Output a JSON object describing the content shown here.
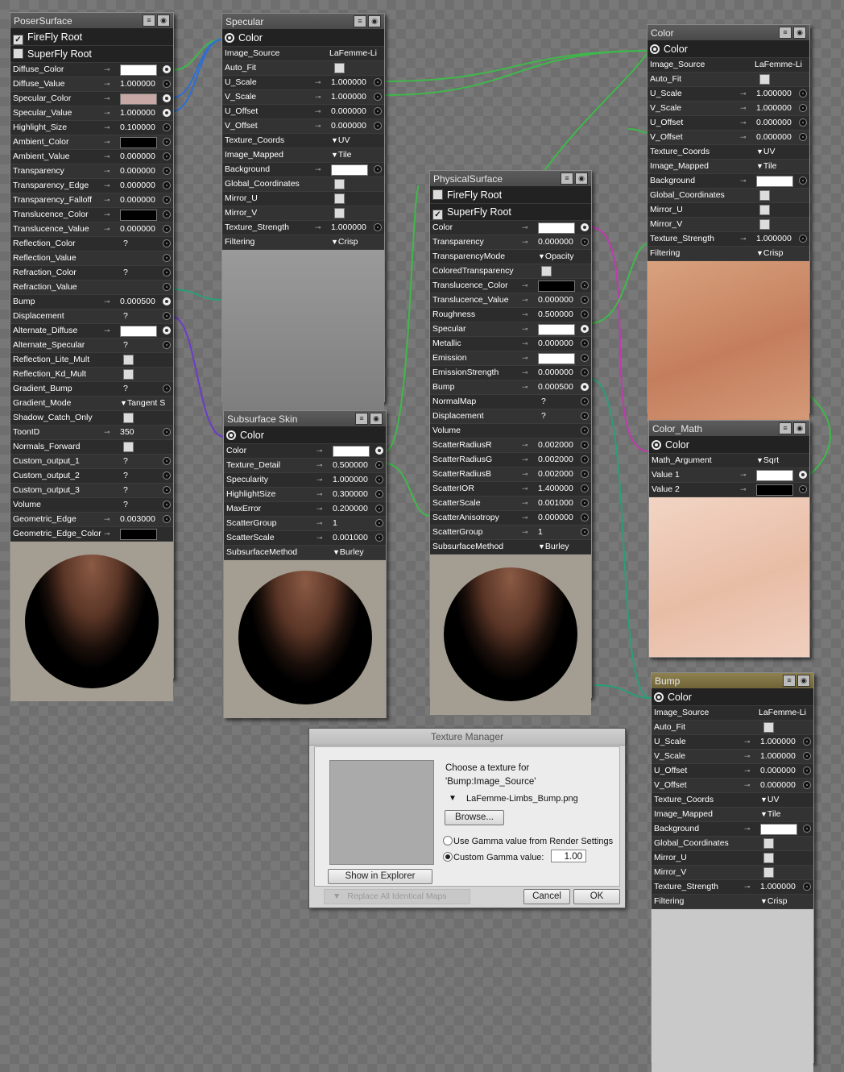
{
  "colors": {
    "accent_wire_green": "#3fb84a",
    "accent_wire_blue": "#2f6fd0",
    "accent_wire_purple": "#6a3cc8",
    "accent_wire_magenta": "#c03ab0",
    "accent_wire_teal": "#2a9e7a"
  },
  "poser": {
    "title": "PoserSurface",
    "root1": "FireFly Root",
    "root2": "SuperFly Root",
    "rows": [
      {
        "l": "Diffuse_Color",
        "t": "sw",
        "c": "#ffffff",
        "p": "out"
      },
      {
        "l": "Diffuse_Value",
        "t": "num",
        "v": "1.000000",
        "p": "in"
      },
      {
        "l": "Specular_Color",
        "t": "sw",
        "c": "#c8a8a4",
        "p": "out"
      },
      {
        "l": "Specular_Value",
        "t": "num",
        "v": "1.000000",
        "p": "out"
      },
      {
        "l": "Highlight_Size",
        "t": "num",
        "v": "0.100000",
        "p": "in"
      },
      {
        "l": "Ambient_Color",
        "t": "sw",
        "c": "#000000",
        "p": "in"
      },
      {
        "l": "Ambient_Value",
        "t": "num",
        "v": "0.000000",
        "p": "in"
      },
      {
        "l": "Transparency",
        "t": "num",
        "v": "0.000000",
        "p": "in"
      },
      {
        "l": "Transparency_Edge",
        "t": "num",
        "v": "0.000000",
        "p": "in"
      },
      {
        "l": "Transparency_Falloff",
        "t": "num",
        "v": "0.000000",
        "p": "in"
      },
      {
        "l": "Translucence_Color",
        "t": "sw",
        "c": "#000000",
        "p": "in"
      },
      {
        "l": "Translucence_Value",
        "t": "num",
        "v": "0.000000",
        "p": "in"
      },
      {
        "l": "Reflection_Color",
        "t": "q",
        "v": "?",
        "p": "in"
      },
      {
        "l": "Reflection_Value",
        "t": "none",
        "p": "in"
      },
      {
        "l": "Refraction_Color",
        "t": "q",
        "v": "?",
        "p": "in"
      },
      {
        "l": "Refraction_Value",
        "t": "none",
        "p": "in"
      },
      {
        "l": "Bump",
        "t": "num",
        "v": "0.000500",
        "p": "out"
      },
      {
        "l": "Displacement",
        "t": "q",
        "v": "?",
        "p": "in"
      },
      {
        "l": "Alternate_Diffuse",
        "t": "sw",
        "c": "#ffffff",
        "p": "out"
      },
      {
        "l": "Alternate_Specular",
        "t": "q",
        "v": "?",
        "p": "in"
      },
      {
        "l": "Reflection_Lite_Mult",
        "t": "chk"
      },
      {
        "l": "Reflection_Kd_Mult",
        "t": "chk"
      },
      {
        "l": "Gradient_Bump",
        "t": "q",
        "v": "?",
        "p": "in"
      },
      {
        "l": "Gradient_Mode",
        "t": "drop",
        "v": "Tangent S"
      },
      {
        "l": "Shadow_Catch_Only",
        "t": "chk"
      },
      {
        "l": "ToonID",
        "t": "num",
        "v": "350",
        "p": "in"
      },
      {
        "l": "Normals_Forward",
        "t": "chk"
      },
      {
        "l": "Custom_output_1",
        "t": "q",
        "v": "?",
        "p": "in"
      },
      {
        "l": "Custom_output_2",
        "t": "q",
        "v": "?",
        "p": "in"
      },
      {
        "l": "Custom_output_3",
        "t": "q",
        "v": "?",
        "p": "in"
      },
      {
        "l": "Volume",
        "t": "q",
        "v": "?",
        "p": "in"
      },
      {
        "l": "Geometric_Edge",
        "t": "num",
        "v": "0.003000",
        "p": "in"
      },
      {
        "l": "Geometric_Edge_Color",
        "t": "sw",
        "c": "#000000",
        "p": "none"
      }
    ]
  },
  "specular": {
    "title": "Specular",
    "out": "Color",
    "rows": [
      {
        "l": "Image_Source",
        "t": "text",
        "v": "LaFemme-Li"
      },
      {
        "l": "Auto_Fit",
        "t": "chk"
      },
      {
        "l": "U_Scale",
        "t": "num",
        "v": "1.000000",
        "p": "in"
      },
      {
        "l": "V_Scale",
        "t": "num",
        "v": "1.000000",
        "p": "in"
      },
      {
        "l": "U_Offset",
        "t": "num",
        "v": "0.000000",
        "p": "in"
      },
      {
        "l": "V_Offset",
        "t": "num",
        "v": "0.000000",
        "p": "in"
      },
      {
        "l": "Texture_Coords",
        "t": "drop",
        "v": "UV"
      },
      {
        "l": "Image_Mapped",
        "t": "drop",
        "v": "Tile"
      },
      {
        "l": "Background",
        "t": "sw",
        "c": "#ffffff",
        "p": "in"
      },
      {
        "l": "Global_Coordinates",
        "t": "chk"
      },
      {
        "l": "Mirror_U",
        "t": "chk"
      },
      {
        "l": "Mirror_V",
        "t": "chk"
      },
      {
        "l": "Texture_Strength",
        "t": "num",
        "v": "1.000000",
        "p": "in"
      },
      {
        "l": "Filtering",
        "t": "drop",
        "v": "Crisp"
      }
    ]
  },
  "subsurface": {
    "title": "Subsurface Skin",
    "out": "Color",
    "rows": [
      {
        "l": "Color",
        "t": "sw",
        "c": "#ffffff",
        "p": "out"
      },
      {
        "l": "Texture_Detail",
        "t": "num",
        "v": "0.500000",
        "p": "in"
      },
      {
        "l": "Specularity",
        "t": "num",
        "v": "1.000000",
        "p": "in"
      },
      {
        "l": "HighlightSize",
        "t": "num",
        "v": "0.300000",
        "p": "in"
      },
      {
        "l": "MaxError",
        "t": "num",
        "v": "0.200000",
        "p": "in"
      },
      {
        "l": "ScatterGroup",
        "t": "num",
        "v": "1",
        "p": "in"
      },
      {
        "l": "ScatterScale",
        "t": "num",
        "v": "0.001000",
        "p": "in"
      },
      {
        "l": "SubsurfaceMethod",
        "t": "drop",
        "v": "Burley"
      }
    ]
  },
  "physical": {
    "title": "PhysicalSurface",
    "root1": "FireFly Root",
    "root2": "SuperFly Root",
    "rows": [
      {
        "l": "Color",
        "t": "sw",
        "c": "#ffffff",
        "p": "out"
      },
      {
        "l": "Transparency",
        "t": "num",
        "v": "0.000000",
        "p": "in"
      },
      {
        "l": "TransparencyMode",
        "t": "drop",
        "v": "Opacity"
      },
      {
        "l": "ColoredTransparency",
        "t": "chk"
      },
      {
        "l": "Translucence_Color",
        "t": "sw",
        "c": "#000000",
        "p": "in"
      },
      {
        "l": "Translucence_Value",
        "t": "num",
        "v": "0.000000",
        "p": "in"
      },
      {
        "l": "Roughness",
        "t": "num",
        "v": "0.500000",
        "p": "in"
      },
      {
        "l": "Specular",
        "t": "sw",
        "c": "#ffffff",
        "p": "out"
      },
      {
        "l": "Metallic",
        "t": "num",
        "v": "0.000000",
        "p": "in"
      },
      {
        "l": "Emission",
        "t": "sw",
        "c": "#ffffff",
        "p": "in"
      },
      {
        "l": "EmissionStrength",
        "t": "num",
        "v": "0.000000",
        "p": "in"
      },
      {
        "l": "Bump",
        "t": "num",
        "v": "0.000500",
        "p": "out"
      },
      {
        "l": "NormalMap",
        "t": "q",
        "v": "?",
        "p": "in"
      },
      {
        "l": "Displacement",
        "t": "q",
        "v": "?",
        "p": "in"
      },
      {
        "l": "Volume",
        "t": "none",
        "p": "in"
      },
      {
        "l": "ScatterRadiusR",
        "t": "num",
        "v": "0.002000",
        "p": "in"
      },
      {
        "l": "ScatterRadiusG",
        "t": "num",
        "v": "0.002000",
        "p": "in"
      },
      {
        "l": "ScatterRadiusB",
        "t": "num",
        "v": "0.002000",
        "p": "in"
      },
      {
        "l": "ScatterIOR",
        "t": "num",
        "v": "1.400000",
        "p": "in"
      },
      {
        "l": "ScatterScale",
        "t": "num",
        "v": "0.001000",
        "p": "in"
      },
      {
        "l": "ScatterAnisotropy",
        "t": "num",
        "v": "0.000000",
        "p": "in"
      },
      {
        "l": "ScatterGroup",
        "t": "num",
        "v": "1",
        "p": "in"
      },
      {
        "l": "SubsurfaceMethod",
        "t": "drop",
        "v": "Burley"
      }
    ]
  },
  "color": {
    "title": "Color",
    "out": "Color",
    "rows": [
      {
        "l": "Image_Source",
        "t": "text",
        "v": "LaFemme-Li"
      },
      {
        "l": "Auto_Fit",
        "t": "chk"
      },
      {
        "l": "U_Scale",
        "t": "num",
        "v": "1.000000",
        "p": "in"
      },
      {
        "l": "V_Scale",
        "t": "num",
        "v": "1.000000",
        "p": "in"
      },
      {
        "l": "U_Offset",
        "t": "num",
        "v": "0.000000",
        "p": "in"
      },
      {
        "l": "V_Offset",
        "t": "num",
        "v": "0.000000",
        "p": "in"
      },
      {
        "l": "Texture_Coords",
        "t": "drop",
        "v": "UV"
      },
      {
        "l": "Image_Mapped",
        "t": "drop",
        "v": "Tile"
      },
      {
        "l": "Background",
        "t": "sw",
        "c": "#ffffff",
        "p": "in"
      },
      {
        "l": "Global_Coordinates",
        "t": "chk"
      },
      {
        "l": "Mirror_U",
        "t": "chk"
      },
      {
        "l": "Mirror_V",
        "t": "chk"
      },
      {
        "l": "Texture_Strength",
        "t": "num",
        "v": "1.000000",
        "p": "in"
      },
      {
        "l": "Filtering",
        "t": "drop",
        "v": "Crisp"
      }
    ]
  },
  "colormath": {
    "title": "Color_Math",
    "out": "Color",
    "rows": [
      {
        "l": "Math_Argument",
        "t": "drop",
        "v": "Sqrt"
      },
      {
        "l": "Value 1",
        "t": "sw",
        "c": "#ffffff",
        "p": "out"
      },
      {
        "l": "Value 2",
        "t": "sw",
        "c": "#000000",
        "p": "in"
      }
    ]
  },
  "bump": {
    "title": "Bump",
    "out": "Color",
    "rows": [
      {
        "l": "Image_Source",
        "t": "text",
        "v": "LaFemme-Li"
      },
      {
        "l": "Auto_Fit",
        "t": "chk"
      },
      {
        "l": "U_Scale",
        "t": "num",
        "v": "1.000000",
        "p": "in"
      },
      {
        "l": "V_Scale",
        "t": "num",
        "v": "1.000000",
        "p": "in"
      },
      {
        "l": "U_Offset",
        "t": "num",
        "v": "0.000000",
        "p": "in"
      },
      {
        "l": "V_Offset",
        "t": "num",
        "v": "0.000000",
        "p": "in"
      },
      {
        "l": "Texture_Coords",
        "t": "drop",
        "v": "UV"
      },
      {
        "l": "Image_Mapped",
        "t": "drop",
        "v": "Tile"
      },
      {
        "l": "Background",
        "t": "sw",
        "c": "#ffffff",
        "p": "in"
      },
      {
        "l": "Global_Coordinates",
        "t": "chk"
      },
      {
        "l": "Mirror_U",
        "t": "chk"
      },
      {
        "l": "Mirror_V",
        "t": "chk"
      },
      {
        "l": "Texture_Strength",
        "t": "num",
        "v": "1.000000",
        "p": "in"
      },
      {
        "l": "Filtering",
        "t": "drop",
        "v": "Crisp"
      }
    ]
  },
  "texture_manager": {
    "title": "Texture Manager",
    "prompt1": "Choose a texture for",
    "prompt2": "'Bump:Image_Source'",
    "file": "LaFemme-Limbs_Bump.png",
    "browse": "Browse...",
    "gamma_render": "Use Gamma value from Render Settings",
    "gamma_custom": "Custom Gamma value:",
    "gamma_value": "1.00",
    "show_explorer": "Show in Explorer",
    "replace_all": "Replace All Identical Maps",
    "cancel": "Cancel",
    "ok": "OK"
  }
}
